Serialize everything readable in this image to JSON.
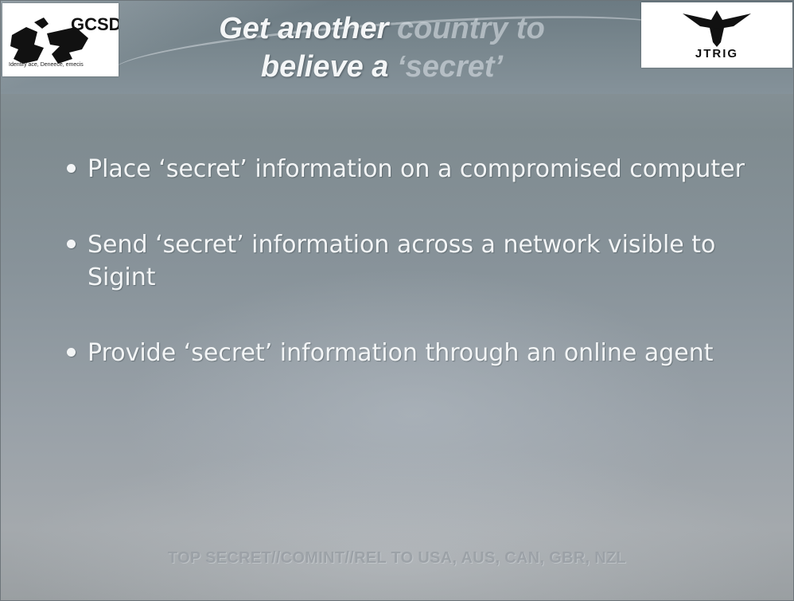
{
  "header": {
    "title_line1_main": "Get another",
    "title_line1_faded": "country to",
    "title_line2_main": "believe a",
    "title_line2_faded": "‘secret’"
  },
  "logos": {
    "left": {
      "text": "GCSD",
      "caption": "Identify ace, Deneece, emecis",
      "icon": "gcsd-logo-icon"
    },
    "right": {
      "text": "JTRIG",
      "icon": "jtrig-bat-emblem-icon"
    }
  },
  "bullets": [
    {
      "text": "Place ‘secret’ information on a compromised computer"
    },
    {
      "text": "Send ‘secret’ information across a network visible to Sigint"
    },
    {
      "text": "Provide ‘secret’ information through an online agent"
    }
  ],
  "footer": {
    "classification": "TOP SECRET//COMINT//REL TO USA, AUS, CAN, GBR, NZL"
  },
  "colors": {
    "text": "#f3f5f6",
    "background": "#8d9498",
    "classification": "#969ca2"
  }
}
